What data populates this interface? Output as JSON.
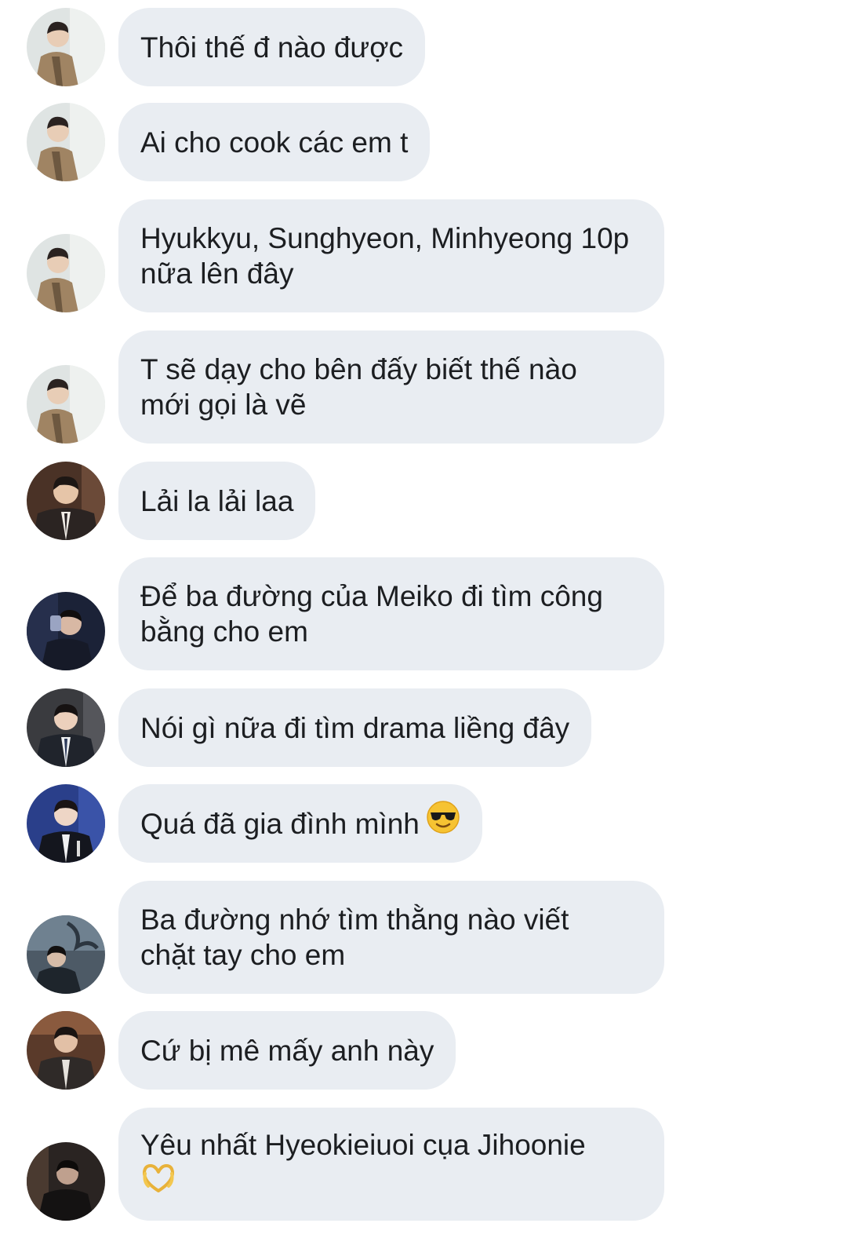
{
  "messages": [
    {
      "avatar": "avatar-suit-beige",
      "lines": [
        "Thôi thế đ nào được"
      ]
    },
    {
      "avatar": "avatar-suit-beige",
      "lines": [
        "Ai cho cook các em t"
      ]
    },
    {
      "avatar": "avatar-suit-beige",
      "lines": [
        "Hyukkyu, Sunghyeon, Minhyeong 10p",
        "nữa lên đây"
      ]
    },
    {
      "avatar": "avatar-suit-beige",
      "lines": [
        "T sẽ dạy cho bên đấy biết thế nào",
        "mới gọi là vẽ"
      ]
    },
    {
      "avatar": "avatar-man-dark-suit",
      "lines": [
        "Lải la lải laa"
      ]
    },
    {
      "avatar": "avatar-man-drinking",
      "lines": [
        "Để ba đường của Meiko đi tìm công",
        "bằng cho em"
      ]
    },
    {
      "avatar": "avatar-man-tie",
      "lines": [
        "Nói gì nữa đi tìm drama liềng đây"
      ]
    },
    {
      "avatar": "avatar-man-event",
      "lines": [
        "Quá đã gia đình mình"
      ],
      "emoji": "sunglasses-emoji"
    },
    {
      "avatar": "avatar-man-seated",
      "lines": [
        "Ba đường nhớ tìm thằng nào viết",
        "chặt tay cho em"
      ]
    },
    {
      "avatar": "avatar-man-brown-suit",
      "lines": [
        "Cứ bị mê mấy anh này"
      ]
    },
    {
      "avatar": "avatar-man-dark-room",
      "lines": [
        "Yêu nhất Hyeokieiuoi cụa Jihoonie"
      ],
      "emoji": "heart-hands-emoji"
    }
  ],
  "colors": {
    "bubble": "#e9edf2",
    "text": "#1c1e21",
    "background": "#ffffff"
  }
}
